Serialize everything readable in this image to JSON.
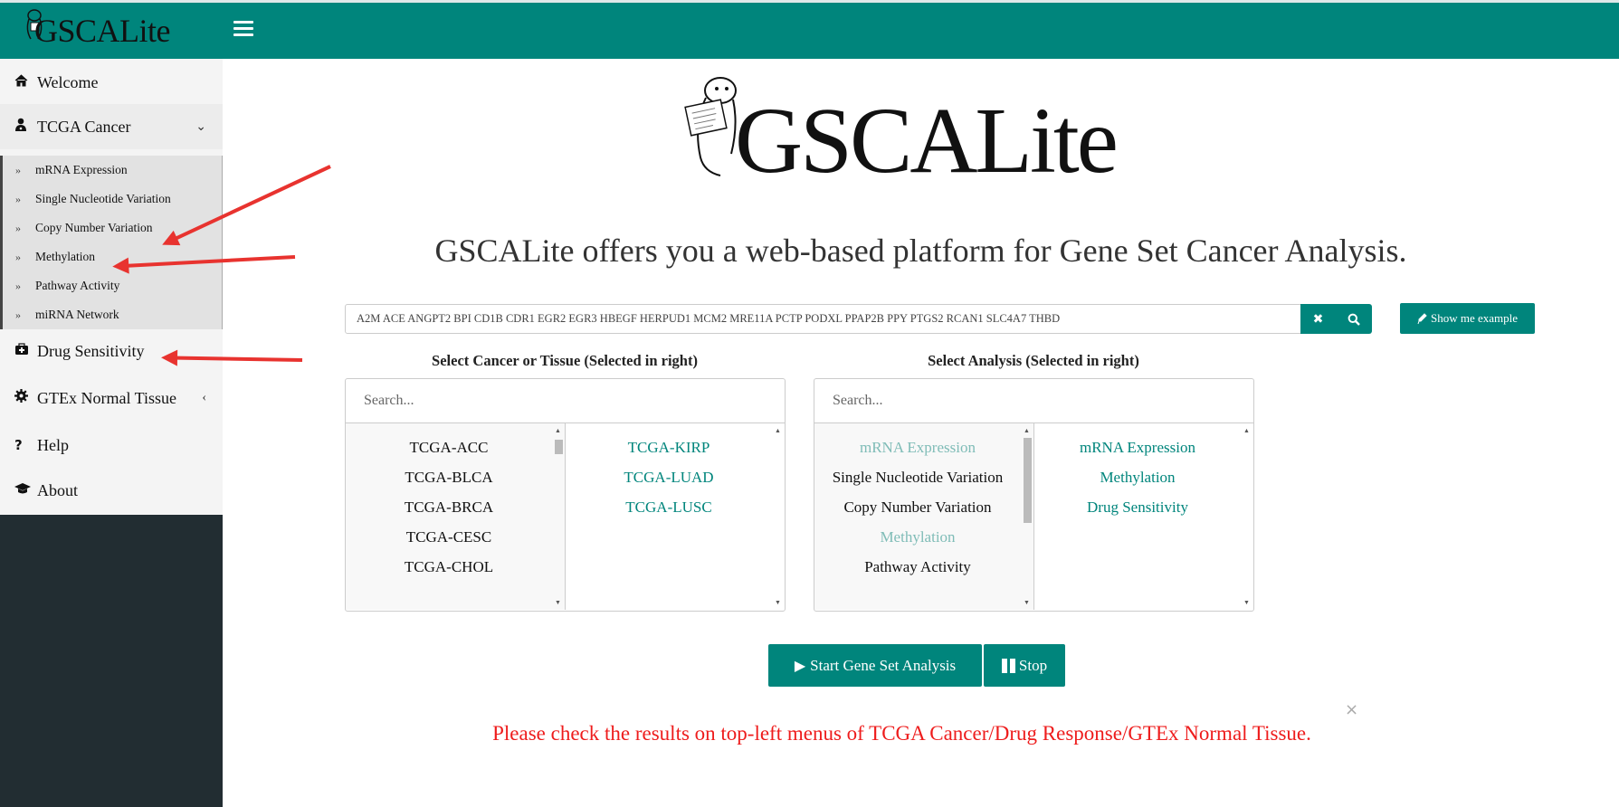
{
  "app": {
    "logo_text": "GSCALite",
    "main_logo_text": "GSCALite"
  },
  "sidebar": {
    "items": [
      {
        "label": "Welcome",
        "icon": "home-icon"
      },
      {
        "label": "TCGA Cancer",
        "icon": "user-md-icon"
      },
      {
        "label": "Drug Sensitivity",
        "icon": "medkit-icon"
      },
      {
        "label": "GTEx Normal Tissue",
        "icon": "gear-icon"
      },
      {
        "label": "Help",
        "icon": "question-icon"
      },
      {
        "label": "About",
        "icon": "graduation-cap-icon"
      }
    ],
    "tcga_submenu": [
      "mRNA Expression",
      "Single Nucleotide Variation",
      "Copy Number Variation",
      "Methylation",
      "Pathway Activity",
      "miRNA Network"
    ]
  },
  "tagline": "GSCALite offers you a web-based platform for Gene Set Cancer Analysis.",
  "gene_input": {
    "value": "A2M ACE ANGPT2 BPI CD1B CDR1 EGR2 EGR3 HBEGF HERPUD1 MCM2 MRE11A PCTP PODXL PPAP2B PPY PTGS2 RCAN1 SLC4A7 THBD"
  },
  "buttons": {
    "show_example": "Show me example",
    "start": "Start Gene Set Analysis",
    "stop": "Stop"
  },
  "cancer_selector": {
    "title": "Select Cancer or Tissue (Selected in right)",
    "search_placeholder": "Search...",
    "available": [
      "TCGA-ACC",
      "TCGA-BLCA",
      "TCGA-BRCA",
      "TCGA-CESC",
      "TCGA-CHOL"
    ],
    "selected": [
      "TCGA-KIRP",
      "TCGA-LUAD",
      "TCGA-LUSC"
    ]
  },
  "analysis_selector": {
    "title": "Select Analysis (Selected in right)",
    "search_placeholder": "Search...",
    "available": [
      "mRNA Expression",
      "Single Nucleotide Variation",
      "Copy Number Variation",
      "Methylation",
      "Pathway Activity"
    ],
    "selected": [
      "mRNA Expression",
      "Methylation",
      "Drug Sensitivity"
    ]
  },
  "notice": "Please check the results on top-left menus of TCGA Cancer/Drug Response/GTEx Normal Tissue.",
  "colors": {
    "brand": "#00857c",
    "notice": "#ee1c1c",
    "sidebar_dark": "#222d32",
    "annotation_arrow": "#e8332f"
  }
}
